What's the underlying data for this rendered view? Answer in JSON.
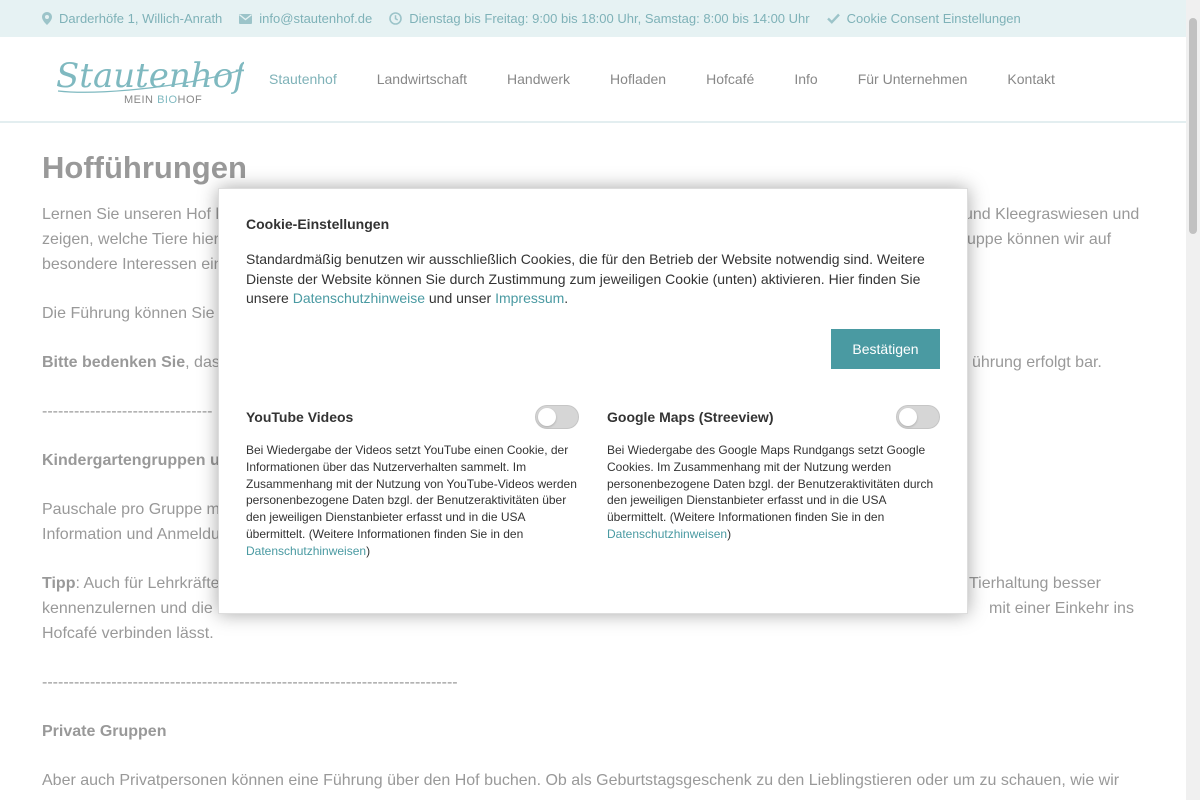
{
  "topbar": {
    "address": "Darderhöfe 1, Willich-Anrath",
    "email": "info@stautenhof.de",
    "hours": "Dienstag bis Freitag: 9:00 bis 18:00 Uhr, Samstag: 8:00 bis 14:00 Uhr",
    "cookie_settings": "Cookie Consent Einstellungen"
  },
  "logo": {
    "name": "Stautenhof",
    "tagline_1": "MEIN ",
    "tagline_2": "BIO",
    "tagline_3": "HOF"
  },
  "nav": [
    "Stautenhof",
    "Landwirtschaft",
    "Handwerk",
    "Hofladen",
    "Hofcafé",
    "Info",
    "Für Unternehmen",
    "Kontakt"
  ],
  "page": {
    "title": "Hofführungen",
    "l1a": "Lernen Sie unseren Hof k",
    "l1b": "und Kleegraswiesen und",
    "l2a": "zeigen, welche Tiere hier",
    "l2b": "uppe können wir auf",
    "l3": "besondere Interessen ein",
    "l4": "Die Führung können Sie ",
    "l5_bold": "Bitte bedenken Sie",
    "l5a": ", das",
    "l5b": "ührung erfolgt bar.",
    "sep1": "--------------------------------",
    "l6": "Kindergartengruppen u",
    "l7": "Pauschale pro Gruppe m",
    "l8": "Information und Anmeldu",
    "l9_bold": "Tipp",
    "l9a": ": Auch für Lehrkräfte",
    "l9b": "Tierhaltung besser",
    "l10a": "kennenzulernen und die",
    "l10b": "mit einer Einkehr ins",
    "l11": "Hofcafé verbinden lässt.",
    "sep2": "------------------------------------------------------------------------------",
    "l12": "Private Gruppen",
    "l13": "Aber auch Privatpersonen können eine Führung über den Hof buchen. Ob als Geburtstagsgeschenk zu den Lieblingstieren oder um zu schauen, wie wir"
  },
  "modal": {
    "title": "Cookie-Einstellungen",
    "intro_1": "Standardmäßig benutzen wir ausschließlich Cookies, die für den Betrieb der Website notwendig sind. Weitere Dienste der Website können Sie durch Zustimmung zum jeweiligen Cookie (unten) aktivieren. Hier finden Sie unsere ",
    "link_privacy": "Datenschutzhinweise",
    "intro_2": " und unser ",
    "link_imprint": "Impressum",
    "intro_3": ".",
    "confirm_label": "Bestätigen",
    "services": [
      {
        "name": "YouTube Videos",
        "enabled": false,
        "text": "Bei Wiedergabe der Videos setzt YouTube einen Cookie, der Informationen über das Nutzerverhalten sammelt. Im Zusammenhang mit der Nutzung von YouTube-Videos werden personenbezogene Daten bzgl. der Benutzeraktivitäten über den jeweiligen Dienstanbieter erfasst und in die USA übermittelt. (Weitere Informationen finden Sie in den ",
        "link": "Datenschutzhinweisen",
        "close": ")"
      },
      {
        "name": "Google Maps (Streeview)",
        "enabled": false,
        "text": "Bei Wiedergabe des Google Maps Rundgangs setzt Google Cookies. Im Zusammenhang mit der Nutzung werden personenbezogene Daten bzgl. der Benutzeraktivitäten durch den jeweiligen Dienstanbieter erfasst und in die USA übermittelt. (Weitere Informationen finden Sie in den ",
        "link": "Datenschutzhinweisen",
        "close": ")"
      }
    ]
  },
  "colors": {
    "accent": "#4a9aa2",
    "topbar_bg": "#e6f2f3",
    "nav_active": "#7fb2b8"
  },
  "icons": {
    "address": "map-marker-icon",
    "email": "envelope-icon",
    "hours": "clock-icon",
    "cookie": "check-icon"
  }
}
